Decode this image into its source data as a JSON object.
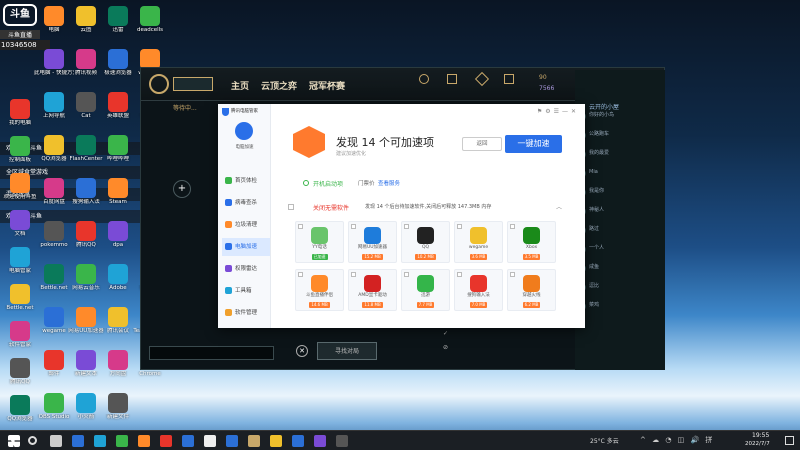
{
  "desktop": {
    "col1": [
      "回收站",
      "我的电脑",
      "控制面板",
      "欢迎使用斗鱼",
      "文档",
      "电脑管家",
      "Bettle.net",
      "软件管家",
      "腾讯QQ",
      "QQ浏览器"
    ],
    "col2": [
      "电脑",
      "此电脑 - 快捷方式",
      "上网导航",
      "QQ浏览器",
      "百度网盘",
      "pokemmo",
      "Bettle.net",
      "wegame",
      "邮件",
      "OBS Studio"
    ],
    "col3": [
      "云图",
      "腾讯视频",
      "Cat",
      "FlashCenter",
      "搜狗输入法",
      "腾讯QQ",
      "网易云音乐",
      "网易UU加速器",
      "新建文本",
      "小火箭"
    ],
    "col4": [
      "迅雷",
      "极速浏览器",
      "英雄联盟",
      "哔哩哔哩",
      "Steam",
      "dpa",
      "Adobe",
      "腾讯会议",
      "方向盘",
      "新建文件"
    ],
    "col5": [
      "deadcells",
      "wegame",
      "Ubisoft",
      "LOL",
      "火绒",
      "Scene",
      "腾讯QQ",
      "TeamViewer",
      "Chrome"
    ],
    "overlay_name": "斗鱼",
    "overlay_sub": "斗鱼直播",
    "overlay_id": "10346508",
    "overlay_lines": [
      "欢迎使用斗鱼",
      "全区域食堂游戏",
      "混战送惠",
      "欢迎观看斗鱼",
      "欢迎来到我的直播间"
    ]
  },
  "client": {
    "nav": [
      "主页",
      "云顶之弈",
      "冠军杯赛"
    ],
    "icons": [
      "主页",
      "藏品",
      "战利品",
      "商店"
    ],
    "currency_rp": "90",
    "currency_be": "7566",
    "party_label": "等待中...",
    "find_match": "寻找对局",
    "chat_placeholder": "发送消息"
  },
  "dialog": {
    "title": "发现 14 个可加速项",
    "subtitle": "建议加速优化",
    "btn_reset": "返回",
    "btn_accel": "一键加速",
    "sidebar_top": "腾讯电脑管家",
    "sidebar_user": "电脑加速",
    "sidebar_items": [
      "首页体检",
      "病毒查杀",
      "垃圾清理",
      "电脑加速",
      "权限雷达",
      "工具箱",
      "软件管理"
    ],
    "section1_title": "开机启动项",
    "section1_extra": "门票价",
    "section1_link": "查看服务",
    "section2_title": "关闭无需软件",
    "section2_desc": "发现 14 个后台待加速软件,关闭后可释放 147.3MB 内存",
    "apps": [
      {
        "name": "YY电话",
        "size": "",
        "color": "#69c46b",
        "badge": "已加速"
      },
      {
        "name": "网易UU加速器",
        "size": "15.2 MB",
        "color": "#1e7cdb"
      },
      {
        "name": "QQ",
        "size": "10.2 MB",
        "color": "#222"
      },
      {
        "name": "wegame",
        "size": "3.6 MB",
        "color": "#f0c02c"
      },
      {
        "name": "Xbox",
        "size": "3.5 MB",
        "color": "#1a8a1a"
      },
      {
        "name": "斗鱼直播伴侣",
        "size": "14.6 MB",
        "color": "#ff8a2a"
      },
      {
        "name": "AMD显卡驱动",
        "size": "11.8 MB",
        "color": "#d32222"
      },
      {
        "name": "迅游",
        "size": "7.7 MB",
        "color": "#34b54a"
      },
      {
        "name": "搜狗输入法",
        "size": "7.0 MB",
        "color": "#e8352b"
      },
      {
        "name": "穿越火线",
        "size": "6.2 MB",
        "color": "#f07c1c"
      }
    ]
  },
  "friends": {
    "header": "云开的小屋",
    "rows": [
      "你好的小鸟",
      "公路跑车",
      "我的最爱",
      "Mia",
      "我是你",
      "神秘人",
      "路过",
      "一个人",
      "咸鱼",
      "逗比",
      "菜鸡"
    ]
  },
  "taskbar": {
    "weather": "25°C 多云",
    "time": "19:55",
    "date": "2022/7/7"
  }
}
